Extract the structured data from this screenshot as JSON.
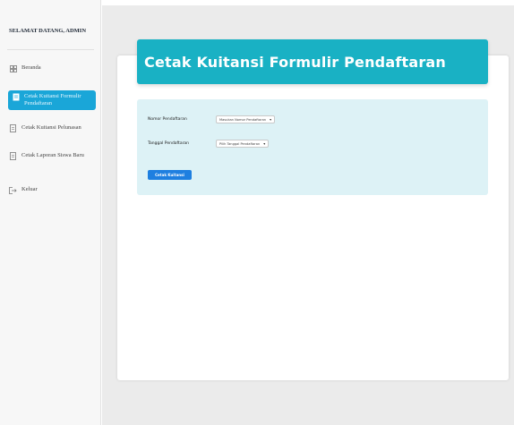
{
  "sidebar": {
    "welcome": "SELAMAT DATANG, ADMIN",
    "items": [
      {
        "label": "Beranda",
        "icon": "grid-icon",
        "active": false
      },
      {
        "label": "Cetak Kuitansi Formulir Pendaftaran",
        "icon": "document-icon",
        "active": true
      },
      {
        "label": "Cetak Kuitansi Pelunasan",
        "icon": "document-icon",
        "active": false
      },
      {
        "label": "Cetak Laporan Siswa Baru",
        "icon": "document-icon",
        "active": false
      },
      {
        "label": "Keluar",
        "icon": "logout-icon",
        "active": false
      }
    ]
  },
  "main": {
    "title": "Cetak Kuitansi Formulir Pendaftaran",
    "form": {
      "nomor_label": "Nomor Pendaftaran",
      "nomor_value": "Masukan Nomor Pendaftaran",
      "tanggal_label": "Tanggal Pendaftaran",
      "tanggal_value": "Pilih Tanggal Pendaftaran",
      "submit_label": "Cetak Kuitansi"
    }
  },
  "colors": {
    "accent": "#19b1c4",
    "panel": "#ddf2f6",
    "active_nav": "#1aa6d8",
    "button": "#1e7fe0"
  }
}
